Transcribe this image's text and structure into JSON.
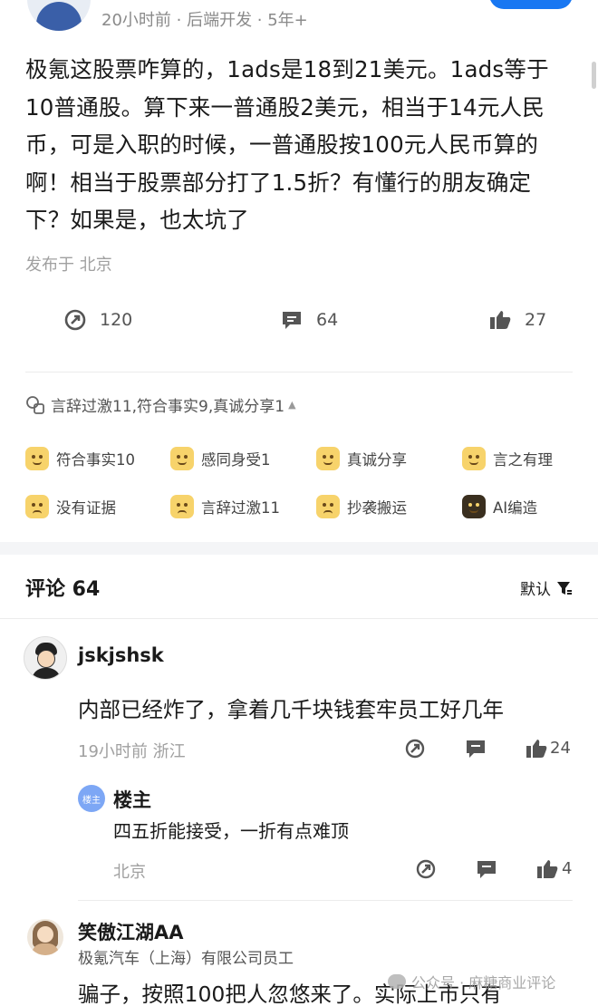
{
  "post": {
    "meta": "20小时前 · 后端开发 · 5年+",
    "body": "极氪这股票咋算的，1ads是18到21美元。1ads等于10普通股。算下来一普通股2美元，相当于14元人民币，可是入职的时候，一普通股按100元人民币算的啊！相当于股票部分打了1.5折？有懂行的朋友确定下？如果是，也太坑了",
    "location": "发布于 北京",
    "actions": {
      "share_count": "120",
      "comment_count": "64",
      "like_count": "27"
    }
  },
  "reaction_summary": "言辞过激11,符合事实9,真诚分享1",
  "reactions": [
    {
      "label": "符合事实10"
    },
    {
      "label": "感同身受1"
    },
    {
      "label": "真诚分享"
    },
    {
      "label": "言之有理"
    },
    {
      "label": "没有证据"
    },
    {
      "label": "言辞过激11"
    },
    {
      "label": "抄袭搬运"
    },
    {
      "label": "AI编造"
    }
  ],
  "comments_header": {
    "title": "评论 64",
    "sort_label": "默认"
  },
  "comments": [
    {
      "name": "jskjshsk",
      "text": "内部已经炸了，拿着几千块钱套牢员工好几年",
      "meta": "19小时前  浙江",
      "like_count": "24"
    },
    {
      "badge": "楼主",
      "name": "楼主",
      "text": "四五折能接受，一折有点难顶",
      "meta": "北京",
      "like_count": "4"
    },
    {
      "name": "笑傲江湖AA",
      "company": "极氪汽车（上海）有限公司员工",
      "text": "骗子，按照100把人忽悠来了。实际上市只有"
    }
  ],
  "watermark": "公众号 · 麻糖商业评论",
  "colors": {
    "accent": "#1877f2",
    "host_badge": "#7da7f5",
    "muted": "#a0a0a0"
  }
}
